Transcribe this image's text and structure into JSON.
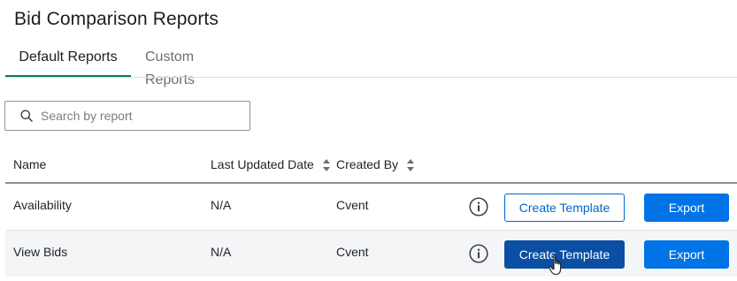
{
  "page": {
    "title": "Bid Comparison Reports"
  },
  "tabs": [
    {
      "label": "Default Reports",
      "active": true
    },
    {
      "label": "Custom Reports",
      "active": false
    }
  ],
  "search": {
    "placeholder": "Search by report",
    "value": ""
  },
  "table": {
    "columns": [
      {
        "label": "Name",
        "sortable": false
      },
      {
        "label": "Last Updated Date",
        "sortable": true
      },
      {
        "label": "Created By",
        "sortable": true
      }
    ],
    "rows": [
      {
        "name": "Availability",
        "last_updated": "N/A",
        "created_by": "Cvent",
        "create_template_label": "Create Template",
        "export_label": "Export"
      },
      {
        "name": "View Bids",
        "last_updated": "N/A",
        "created_by": "Cvent",
        "create_template_label": "Create Template",
        "export_label": "Export"
      }
    ]
  },
  "icons": {
    "search": "search-icon",
    "sort": "sort-icon",
    "info": "info-icon",
    "cursor": "hand-pointer-cursor"
  },
  "colors": {
    "active_tab_underline": "#0a7a5a",
    "primary_button": "#0073e6",
    "hover_button": "#0a4fa3",
    "outline_button": "#0067cc",
    "alt_row": "#f4f5f7"
  }
}
